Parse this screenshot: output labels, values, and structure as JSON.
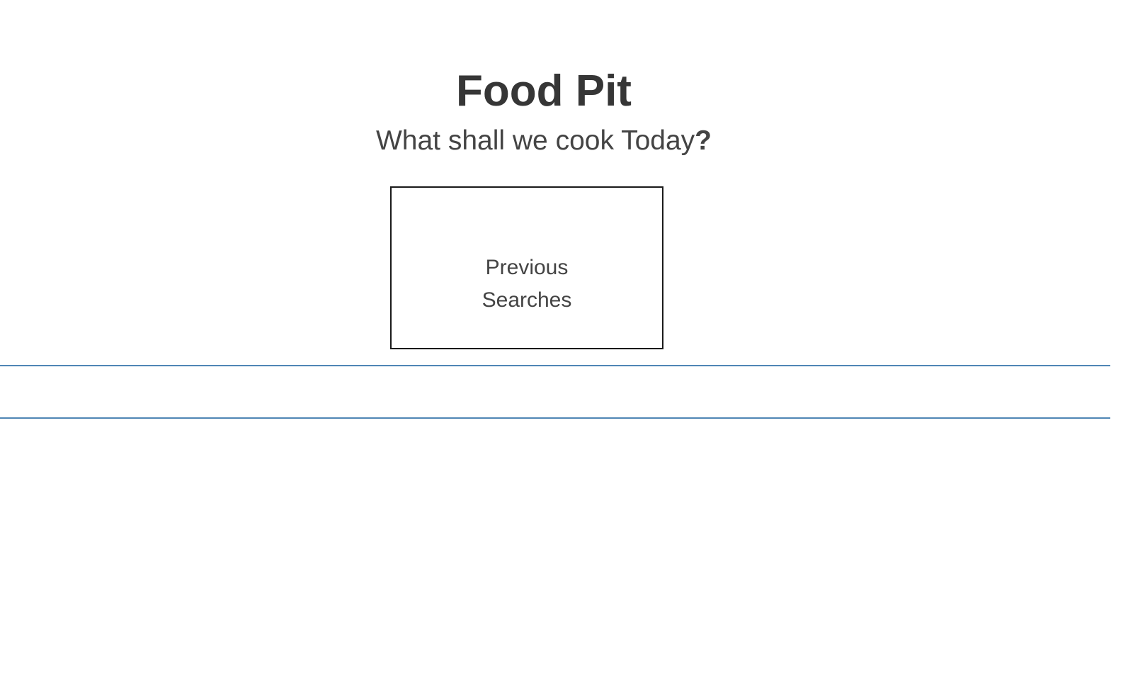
{
  "header": {
    "title": "Food Pit",
    "tagline": "What shall we cook Today",
    "tagline_mark": "?"
  },
  "main": {
    "previous_searches_label": "Previous Searches"
  },
  "colors": {
    "text": "#3a3a3a",
    "strip_border": "#4f86b5",
    "box_border": "#1a1a1a"
  }
}
